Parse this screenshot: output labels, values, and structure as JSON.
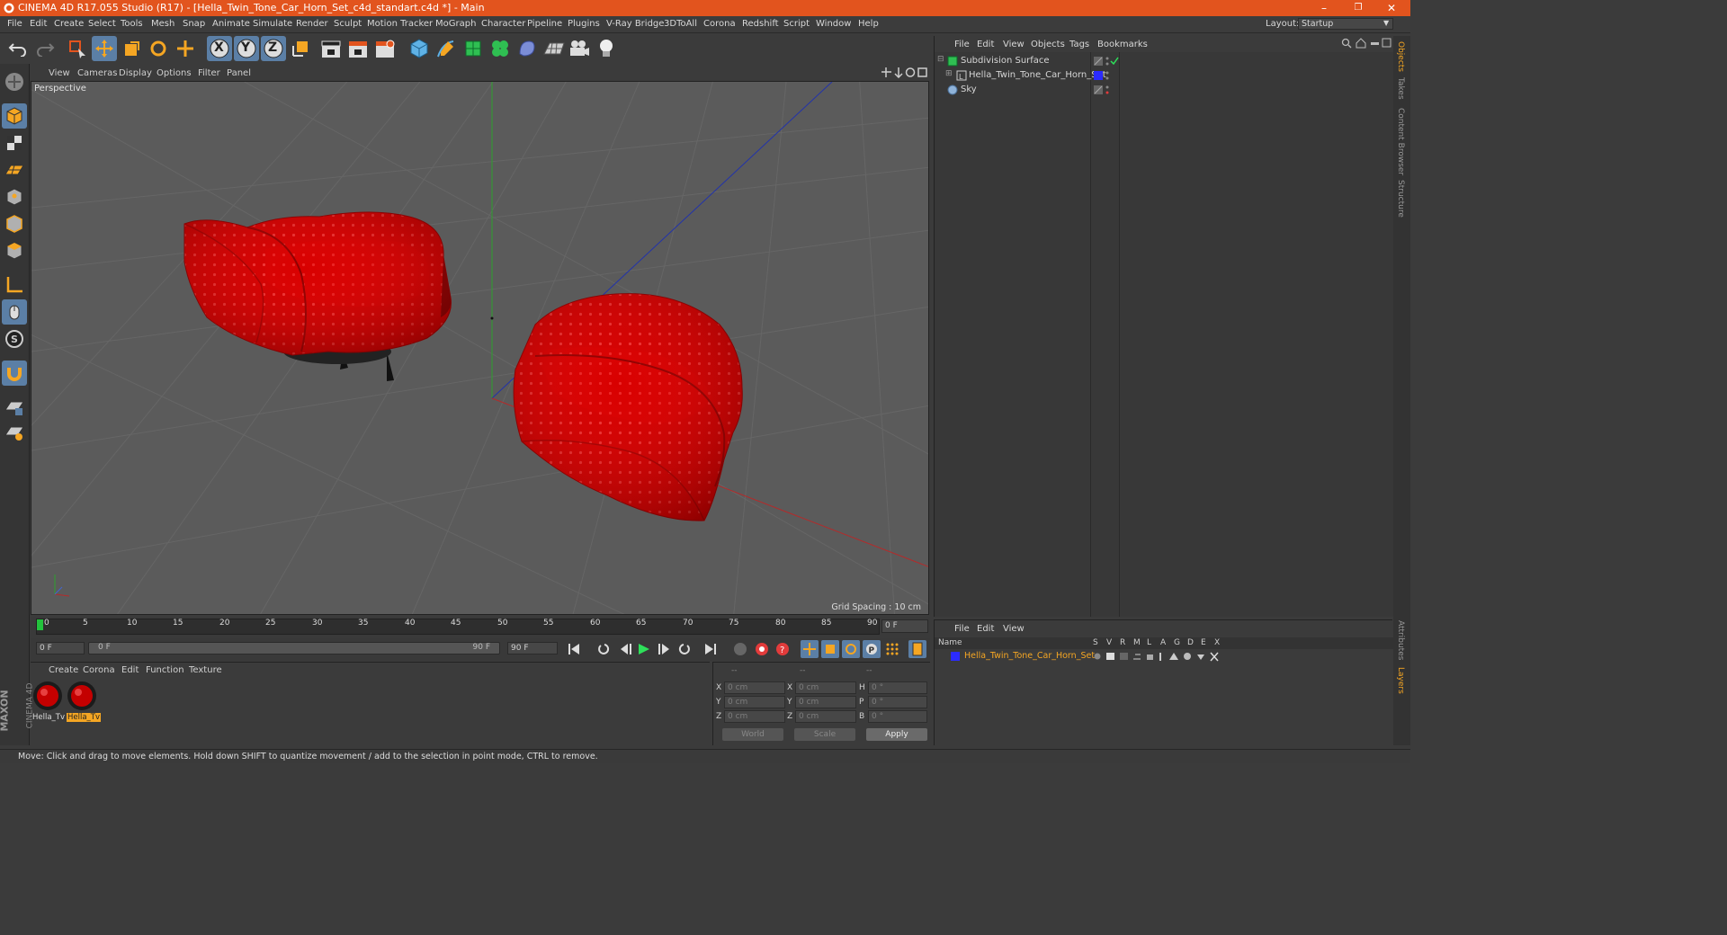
{
  "window": {
    "title": "CINEMA 4D R17.055 Studio (R17) - [Hella_Twin_Tone_Car_Horn_Set_c4d_standart.c4d *] - Main",
    "minimize": "–",
    "restore": "❐",
    "close": "✕"
  },
  "menubar": {
    "items": [
      "File",
      "Edit",
      "Create",
      "Select",
      "Tools",
      "Mesh",
      "Snap",
      "Animate",
      "Simulate",
      "Render",
      "Sculpt",
      "Motion Tracker",
      "MoGraph",
      "Character",
      "Pipeline",
      "Plugins",
      "V-Ray Bridge",
      "3DToAll",
      "Corona",
      "Redshift",
      "Script",
      "Window",
      "Help"
    ],
    "layout_label": "Layout:",
    "layout_value": "Startup"
  },
  "toolbar": {
    "axis_x": "X",
    "axis_y": "Y",
    "axis_z": "Z"
  },
  "viewport": {
    "menu": [
      "View",
      "Cameras",
      "Display",
      "Options",
      "Filter",
      "Panel"
    ],
    "label": "Perspective",
    "grid_spacing": "Grid Spacing : 10 cm"
  },
  "timeline": {
    "ticks": [
      "0",
      "5",
      "10",
      "15",
      "20",
      "25",
      "30",
      "35",
      "40",
      "45",
      "50",
      "55",
      "60",
      "65",
      "70",
      "75",
      "80",
      "85",
      "90"
    ],
    "current_frame": "0 F",
    "start_field": "0 F",
    "range_start": "0 F",
    "range_end": "90 F",
    "end_field": "90 F"
  },
  "materials": {
    "menu": [
      "Create",
      "Corona",
      "Edit",
      "Function",
      "Texture"
    ],
    "items": [
      {
        "label": "Hella_Tv"
      },
      {
        "label": "Hella_Tv"
      }
    ]
  },
  "coords": {
    "header": [
      "--",
      "--",
      "--"
    ],
    "rows": [
      {
        "a": "X",
        "av": "0 cm",
        "b": "X",
        "bv": "0 cm",
        "c": "H",
        "cv": "0 °"
      },
      {
        "a": "Y",
        "av": "0 cm",
        "b": "Y",
        "bv": "0 cm",
        "c": "P",
        "cv": "0 °"
      },
      {
        "a": "Z",
        "av": "0 cm",
        "b": "Z",
        "bv": "0 cm",
        "c": "B",
        "cv": "0 °"
      }
    ],
    "world": "World",
    "scale": "Scale",
    "apply": "Apply"
  },
  "objects": {
    "menu": [
      "File",
      "Edit",
      "View",
      "Objects",
      "Tags",
      "Bookmarks"
    ],
    "tree": [
      {
        "name": "Subdivision Surface"
      },
      {
        "name": "Hella_Twin_Tone_Car_Horn_Set"
      },
      {
        "name": "Sky"
      }
    ]
  },
  "layers": {
    "menu": [
      "File",
      "Edit",
      "View"
    ],
    "name_header": "Name",
    "columns": [
      "S",
      "V",
      "R",
      "M",
      "L",
      "A",
      "G",
      "D",
      "E",
      "X"
    ],
    "rows": [
      {
        "name": "Hella_Twin_Tone_Car_Horn_Set"
      }
    ]
  },
  "right_tabs": [
    "Objects",
    "Takes",
    "Content Browser",
    "Structure",
    "Attributes",
    "Layers"
  ],
  "status": "Move: Click and drag to move elements. Hold down SHIFT to quantize movement / add to the selection in point mode, CTRL to remove.",
  "logo": {
    "line1": "MAXON",
    "line2": "CINEMA 4D"
  },
  "colors": {
    "accent": "#e2541e",
    "selection": "#5b7fa6",
    "horn_red": "#d10000",
    "layer_blue": "#2b2bff"
  }
}
